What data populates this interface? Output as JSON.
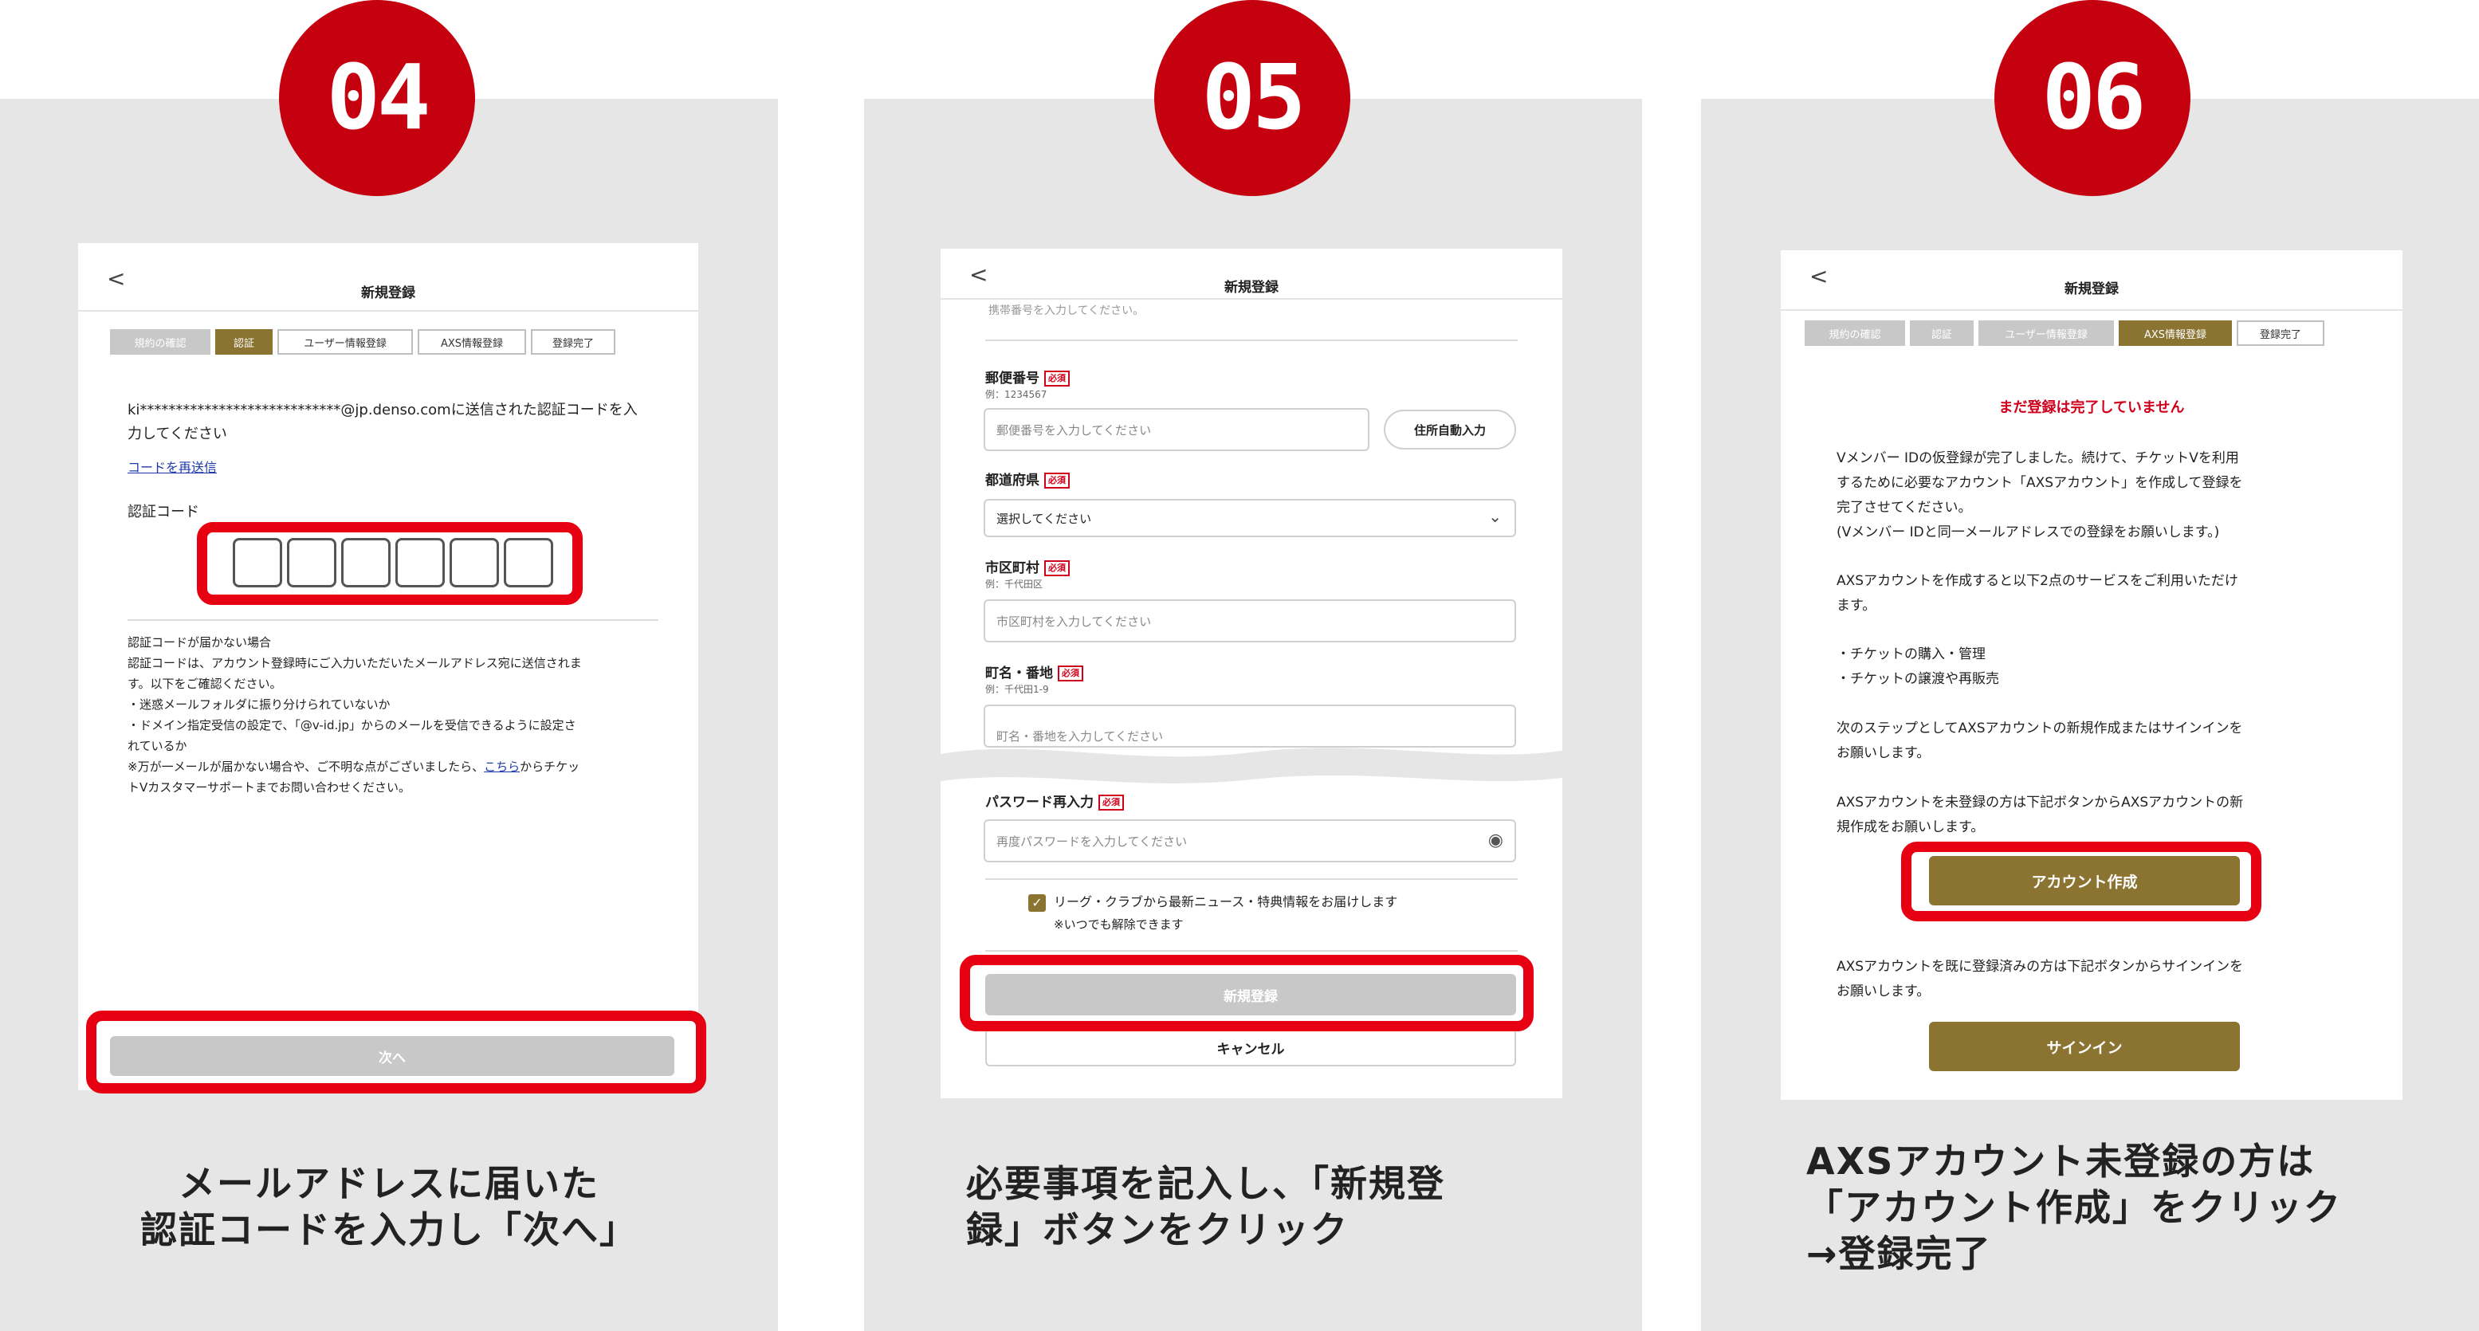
{
  "steps_panels": [
    {
      "number": "04",
      "caption": [
        "メールアドレスに届いた",
        "認証コードを入力し「次へ」"
      ]
    },
    {
      "number": "05",
      "caption": [
        "必要事項を記入し、「新規登",
        "録」ボタンをクリック"
      ]
    },
    {
      "number": "06",
      "caption": [
        "AXSアカウント未登録の方は",
        "「アカウント作成」をクリック",
        "→登録完了"
      ]
    }
  ],
  "screen04": {
    "back": "<",
    "title": "新規登録",
    "steps": [
      "規約の確認",
      "認証",
      "ユーザー情報登録",
      "AXS情報登録",
      "登録完了"
    ],
    "message1": "ki****************************@jp.denso.comに送信された認証コードを入",
    "message2": "力してください",
    "resend": "コードを再送信",
    "code_label": "認証コード",
    "help": [
      "認証コードが届かない場合",
      "認証コードは、アカウント登録時にご入力いただいたメールアドレス宛に送信されま",
      "す。以下をご確認ください。",
      "・迷惑メールフォルダに振り分けられていないか",
      "・ドメイン指定受信の設定で、「@v-id.jp」からのメールを受信できるように設定さ",
      "れているか"
    ],
    "help_last_a": "※万が一メールが届かない場合や、ご不明な点がございましたら、",
    "help_link": "こちら",
    "help_last_b": "からチケッ",
    "help_last_c": "トVカスタマーサポートまでお問い合わせください。",
    "next": "次へ"
  },
  "screen05": {
    "back": "<",
    "title": "新規登録",
    "phone_ph": "携帯番号を入力してください。",
    "required": "必須",
    "postal_label": "郵便番号",
    "postal_ex": "例：1234567",
    "postal_ph": "郵便番号を入力してください",
    "auto_addr": "住所自動入力",
    "pref_label": "都道府県",
    "pref_ph": "選択してください",
    "city_label": "市区町村",
    "city_ex": "例：千代田区",
    "city_ph": "市区町村を入力してください",
    "street_label": "町名・番地",
    "street_ex": "例：千代田1-9",
    "street_ph": "町名・番地を入力してください",
    "pw_label": "パスワード再入力",
    "pw_ph": "再度パスワードを入力してください",
    "news_opt": "リーグ・クラブから最新ニュース・特典情報をお届けします",
    "news_note": "※いつでも解除できます",
    "register": "新規登録",
    "cancel": "キャンセル"
  },
  "screen06": {
    "back": "<",
    "title": "新規登録",
    "steps": [
      "規約の確認",
      "認証",
      "ユーザー情報登録",
      "AXS情報登録",
      "登録完了"
    ],
    "warning": "まだ登録は完了していません",
    "p1": [
      "Vメンバー IDの仮登録が完了しました。続けて、チケットVを利用",
      "するために必要なアカウント「AXSアカウント」を作成して登録を",
      "完了させてください。",
      "(Vメンバー IDと同一メールアドレスでの登録をお願いします。)"
    ],
    "p2": [
      "AXSアカウントを作成すると以下2点のサービスをご利用いただけ",
      "ます。"
    ],
    "p3": [
      "・チケットの購入・管理",
      "・チケットの譲渡や再販売"
    ],
    "p4": [
      "次のステップとしてAXSアカウントの新規作成またはサインインを",
      "お願いします。"
    ],
    "p5": [
      "AXSアカウントを未登録の方は下記ボタンからAXSアカウントの新",
      "規作成をお願いします。"
    ],
    "create": "アカウント作成",
    "p6": [
      "AXSアカウントを既に登録済みの方は下記ボタンからサインインを",
      "お願いします。"
    ],
    "signin": "サインイン"
  },
  "colors": {
    "badge": "#c5000f",
    "highlight": "#e60012",
    "gold": "#8b7432",
    "panel": "#e6e6e6"
  }
}
